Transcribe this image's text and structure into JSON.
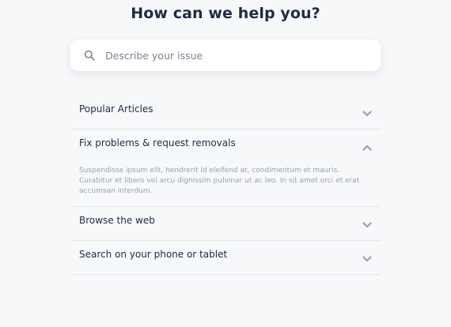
{
  "header": {
    "title": "How can we help you?"
  },
  "search": {
    "placeholder": "Describe your issue",
    "icon": "search-icon"
  },
  "faq": {
    "items": [
      {
        "question": "Popular Articles",
        "expanded": false,
        "icon": "chevron-down-icon"
      },
      {
        "question": "Fix problems & request removals",
        "expanded": true,
        "icon": "chevron-up-icon",
        "answer": "Suspendisse ipsum elit, hendrerit id eleifend at, condimentum et mauris. Curabitur et libero vel arcu dignissim pulvinar ut ac leo. In sit amet orci et erat accumsan interdum."
      },
      {
        "question": "Browse the web",
        "expanded": false,
        "icon": "chevron-down-icon"
      },
      {
        "question": "Search on your phone or tablet",
        "expanded": false,
        "icon": "chevron-down-icon"
      }
    ]
  },
  "colors": {
    "background": "#f7f8fa",
    "heading": "#1f2a44",
    "muted_text": "#9aa0ab",
    "icon": "#9aa0ab",
    "divider": "#e3e5ea"
  }
}
